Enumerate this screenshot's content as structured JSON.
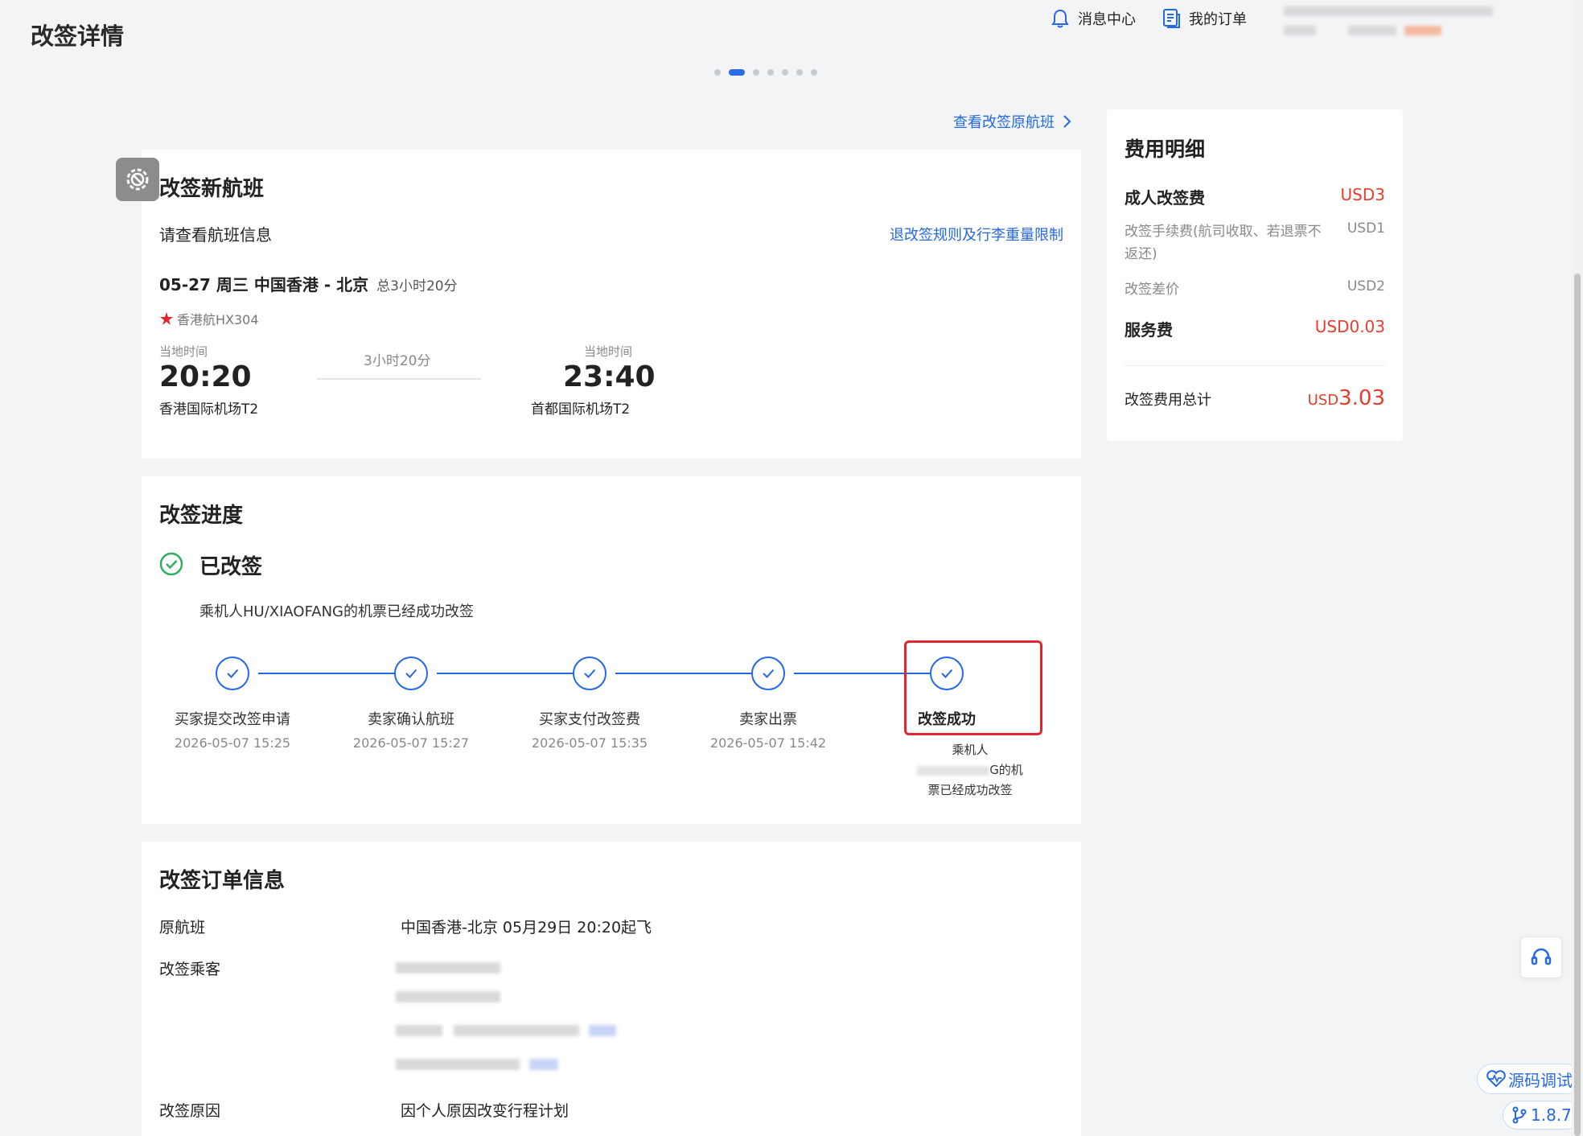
{
  "header": {
    "title": "改签详情",
    "nav": [
      {
        "label": "消息中心",
        "icon": "bell-icon"
      },
      {
        "label": "我的订单",
        "icon": "order-list-icon"
      }
    ]
  },
  "carousel": {
    "count": 7,
    "active_index": 1
  },
  "view_origin": {
    "label": "查看改签原航班"
  },
  "new_flight": {
    "title": "改签新航班",
    "subtitle": "请查看航班信息",
    "rules_link": "退改签规则及行李重量限制",
    "route": "05-27 周三  中国香港 - 北京",
    "total_duration": "总3小时20分",
    "airline": "香港航HX304",
    "departure": {
      "label": "当地时间",
      "time": "20:20",
      "airport": "香港国际机场T2"
    },
    "duration": "3小时20分",
    "arrival": {
      "label": "当地时间",
      "time": "23:40",
      "airport": "首都国际机场T2"
    }
  },
  "progress": {
    "title": "改签进度",
    "status": "已改签",
    "status_desc": "乘机人HU/XIAOFANG的机票已经成功改签",
    "steps": [
      {
        "label": "买家提交改签申请",
        "time": "2026-05-07 15:25"
      },
      {
        "label": "卖家确认航班",
        "time": "2026-05-07 15:27"
      },
      {
        "label": "买家支付改签费",
        "time": "2026-05-07 15:35"
      },
      {
        "label": "卖家出票",
        "time": "2026-05-07 15:42"
      },
      {
        "label": "改签成功",
        "time": ""
      }
    ],
    "final_note_line1": "乘机人",
    "final_note_line2": "G的机",
    "final_note_line3": "票已经成功改签"
  },
  "order_info": {
    "title": "改签订单信息",
    "original_flight_label": "原航班",
    "original_flight_value": "中国香港-北京 05月29日 20:20起飞",
    "passenger_label": "改签乘客",
    "reason_label": "改签原因",
    "reason_value": "因个人原因改变行程计划"
  },
  "fee": {
    "title": "费用明细",
    "adult_label": "成人改签费",
    "adult_value": "USD3",
    "handling_label": "改签手续费(航司收取、若退票不返还)",
    "handling_value": "USD1",
    "diff_label": "改签差价",
    "diff_value": "USD2",
    "service_label": "服务费",
    "service_value": "USD0.03",
    "total_label": "改签费用总计",
    "total_currency": "USD",
    "total_amount": "3.03"
  },
  "floating": {
    "debug_label": "源码调试",
    "version_label": "1.8.7"
  },
  "colors": {
    "accent": "#2468e6",
    "red": "#e53e2f",
    "highlight": "#e0262e"
  }
}
